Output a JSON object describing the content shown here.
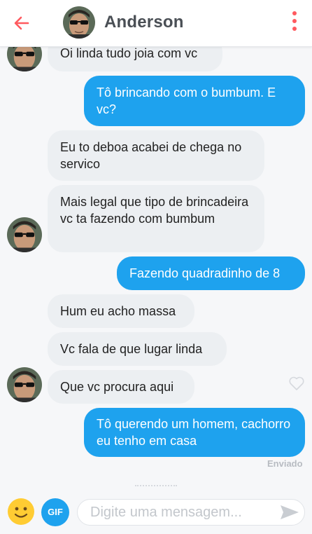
{
  "header": {
    "contact_name": "Anderson",
    "back_icon": "back-arrow-icon",
    "menu_icon": "kebab-menu-icon",
    "accent_color": "#ff5a5f"
  },
  "messages": [
    {
      "side": "in",
      "text": "Oi linda tudo joia com vc"
    },
    {
      "side": "out",
      "text": "Tô brincando com o bumbum. E vc?"
    },
    {
      "side": "in",
      "text": "Eu to deboa acabei de chega no servico"
    },
    {
      "side": "in",
      "text": "Mais legal que tipo de brincadeira vc ta fazendo com bumbum"
    },
    {
      "side": "out",
      "text": "Fazendo quadradinho de 8"
    },
    {
      "side": "in",
      "text": "Hum eu acho massa"
    },
    {
      "side": "in",
      "text": "Vc fala de que lugar linda"
    },
    {
      "side": "in",
      "text": "Que vc procura aqui"
    },
    {
      "side": "out",
      "text": "Tô querendo um homem, cachorro eu tenho em casa"
    }
  ],
  "status": "Enviado",
  "composer": {
    "placeholder": "Digite uma mensagem...",
    "gif_label": "GIF",
    "emoji_icon": "emoji-icon",
    "send_icon": "send-icon"
  },
  "colors": {
    "outgoing_bubble": "#1ea2ee",
    "incoming_bubble": "#eceff2",
    "background": "#f6f7f9"
  }
}
